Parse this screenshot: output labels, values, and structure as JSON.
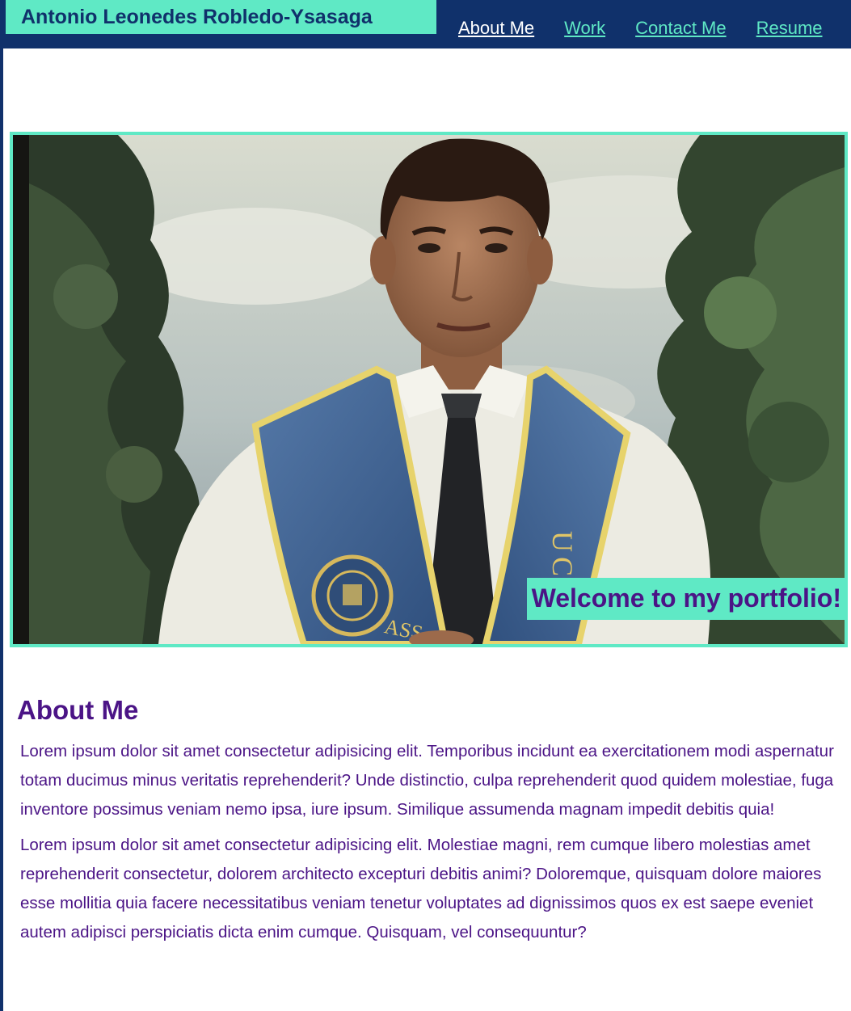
{
  "header": {
    "brand": "Antonio Leonedes Robledo-Ysasaga",
    "nav": [
      {
        "label": "About Me",
        "active": true
      },
      {
        "label": "Work",
        "active": false
      },
      {
        "label": "Contact Me",
        "active": false
      },
      {
        "label": "Resume",
        "active": false
      }
    ]
  },
  "hero": {
    "caption": "Welcome to my portfolio!",
    "stole_letters": "UCR",
    "stole_text": "ASS"
  },
  "about": {
    "title": "About Me",
    "paragraphs": [
      "Lorem ipsum dolor sit amet consectetur adipisicing elit. Temporibus incidunt ea exercitationem modi aspernatur totam ducimus minus veritatis reprehenderit? Unde distinctio, culpa reprehenderit quod quidem molestiae, fuga inventore possimus veniam nemo ipsa, iure ipsum. Similique assumenda magnam impedit debitis quia!",
      "Lorem ipsum dolor sit amet consectetur adipisicing elit. Molestiae magni, rem cumque libero molestias amet reprehenderit consectetur, dolorem architecto excepturi debitis animi? Doloremque, quisquam dolore maiores esse mollitia quia facere necessitatibus veniam tenetur voluptates ad dignissimos quos ex est saepe eveniet autem adipisci perspiciatis dicta enim cumque. Quisquam, vel consequuntur?"
    ]
  },
  "colors": {
    "navy": "#10316b",
    "accent": "#5fe9c5",
    "purple": "#4b1486"
  }
}
